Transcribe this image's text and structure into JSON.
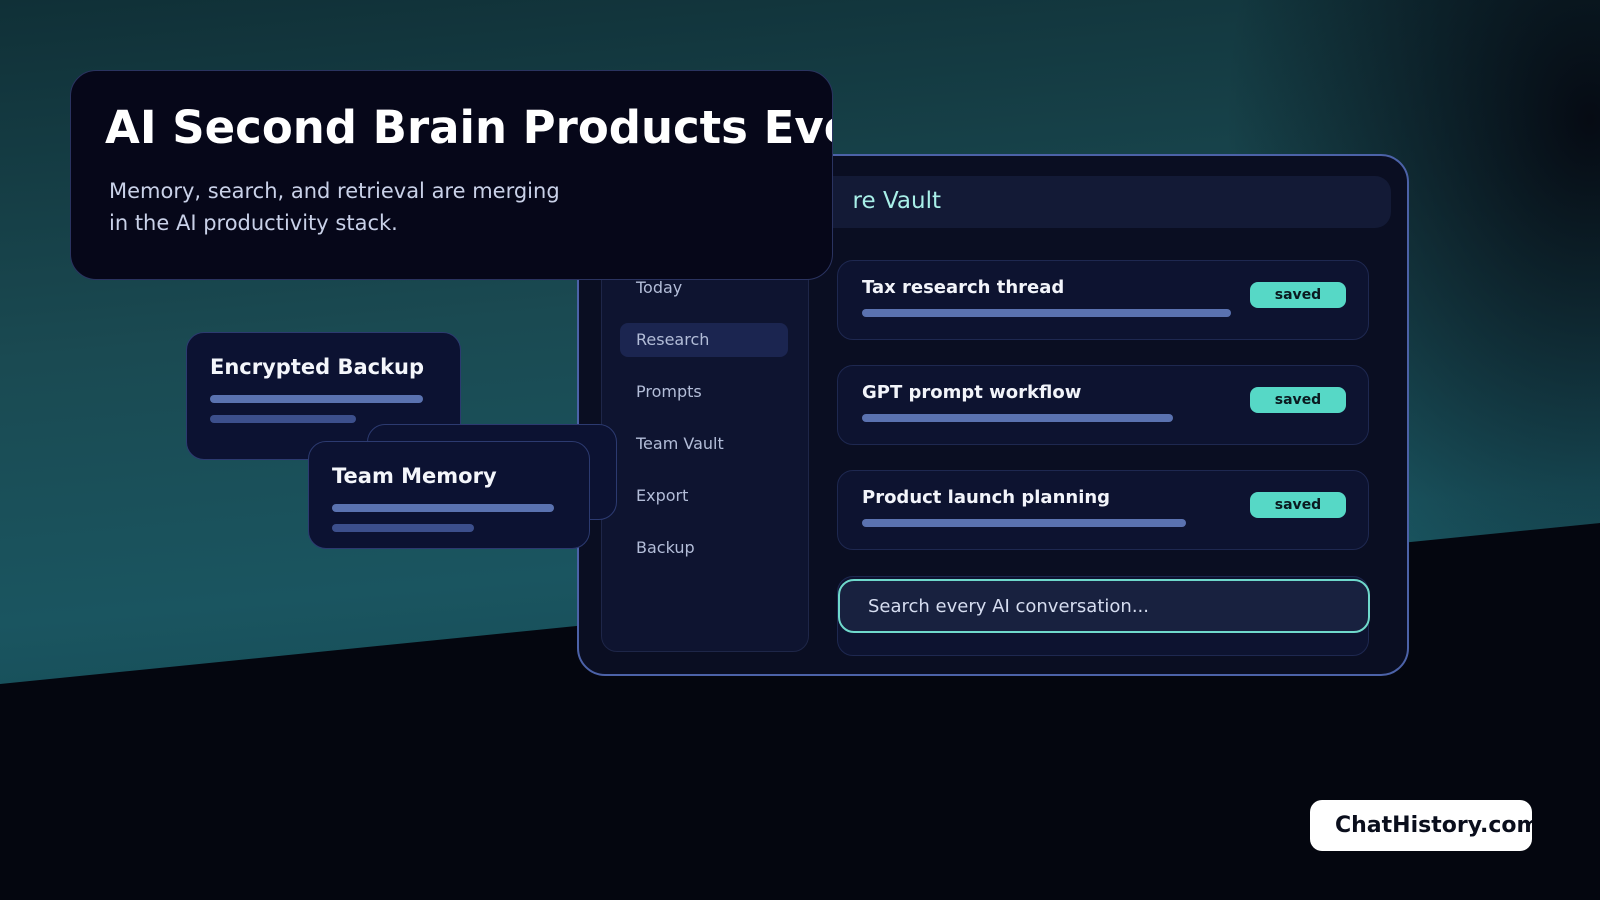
{
  "hero": {
    "title": "AI Second Brain Products Evo",
    "subtitle_line1": "Memory, search, and retrieval are merging",
    "subtitle_line2": "in the AI productivity stack."
  },
  "vault": {
    "header_title": "re Vault",
    "sidebar": [
      {
        "label": "Today",
        "active": false
      },
      {
        "label": "Research",
        "active": true
      },
      {
        "label": "Prompts",
        "active": false
      },
      {
        "label": "Team Vault",
        "active": false
      },
      {
        "label": "Export",
        "active": false
      },
      {
        "label": "Backup",
        "active": false
      }
    ],
    "threads": [
      {
        "title": "Tax research thread",
        "badge": "saved",
        "progress": 0.82
      },
      {
        "title": "GPT prompt workflow",
        "badge": "saved",
        "progress": 0.69
      },
      {
        "title": "Product launch planning",
        "badge": "saved",
        "progress": 0.72
      }
    ],
    "search_placeholder": "Search every AI conversation..."
  },
  "cards": {
    "encrypted_backup": "Encrypted Backup",
    "team_memory": "Team Memory"
  },
  "brand": "ChatHistory.com",
  "colors": {
    "accent": "#56d8c6",
    "panel_border": "#4c62a8",
    "bar": "#5a72b0"
  }
}
